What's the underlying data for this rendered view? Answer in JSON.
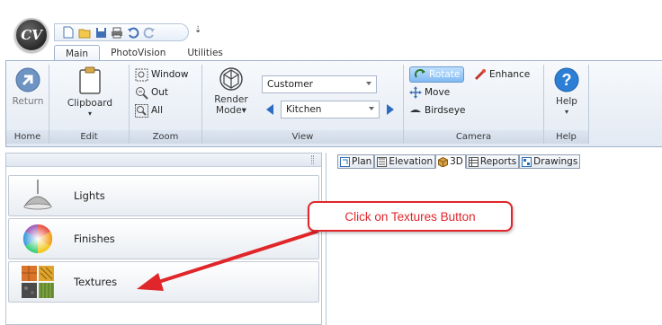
{
  "app": {
    "logo_text": "CV",
    "qat_overflow": "⇣"
  },
  "tabs": [
    "Main",
    "PhotoVision",
    "Utilities"
  ],
  "ribbon": {
    "home": {
      "group_label": "Home",
      "return_label": "Return"
    },
    "edit": {
      "group_label": "Edit",
      "clipboard_label": "Clipboard"
    },
    "zoom": {
      "group_label": "Zoom",
      "window_label": "Window",
      "out_label": "Out",
      "all_label": "All"
    },
    "view": {
      "group_label": "View",
      "render_mode_label_1": "Render",
      "render_mode_label_2": "Mode",
      "customer_value": "Customer",
      "room_value": "Kitchen"
    },
    "camera": {
      "group_label": "Camera",
      "rotate_label": "Rotate",
      "enhance_label": "Enhance",
      "move_label": "Move",
      "birdseye_label": "Birdseye"
    },
    "help": {
      "group_label": "Help",
      "help_label": "Help"
    }
  },
  "left_panel": {
    "items": [
      {
        "label": "Lights",
        "icon": "lamp-icon"
      },
      {
        "label": "Finishes",
        "icon": "color-wheel-icon"
      },
      {
        "label": "Textures",
        "icon": "texture-tiles-icon"
      }
    ]
  },
  "view_tabs": [
    "Plan",
    "Elevation",
    "3D",
    "Reports",
    "Drawings"
  ],
  "callout": {
    "text": "Click on Textures Button",
    "color": "#e0262a"
  }
}
